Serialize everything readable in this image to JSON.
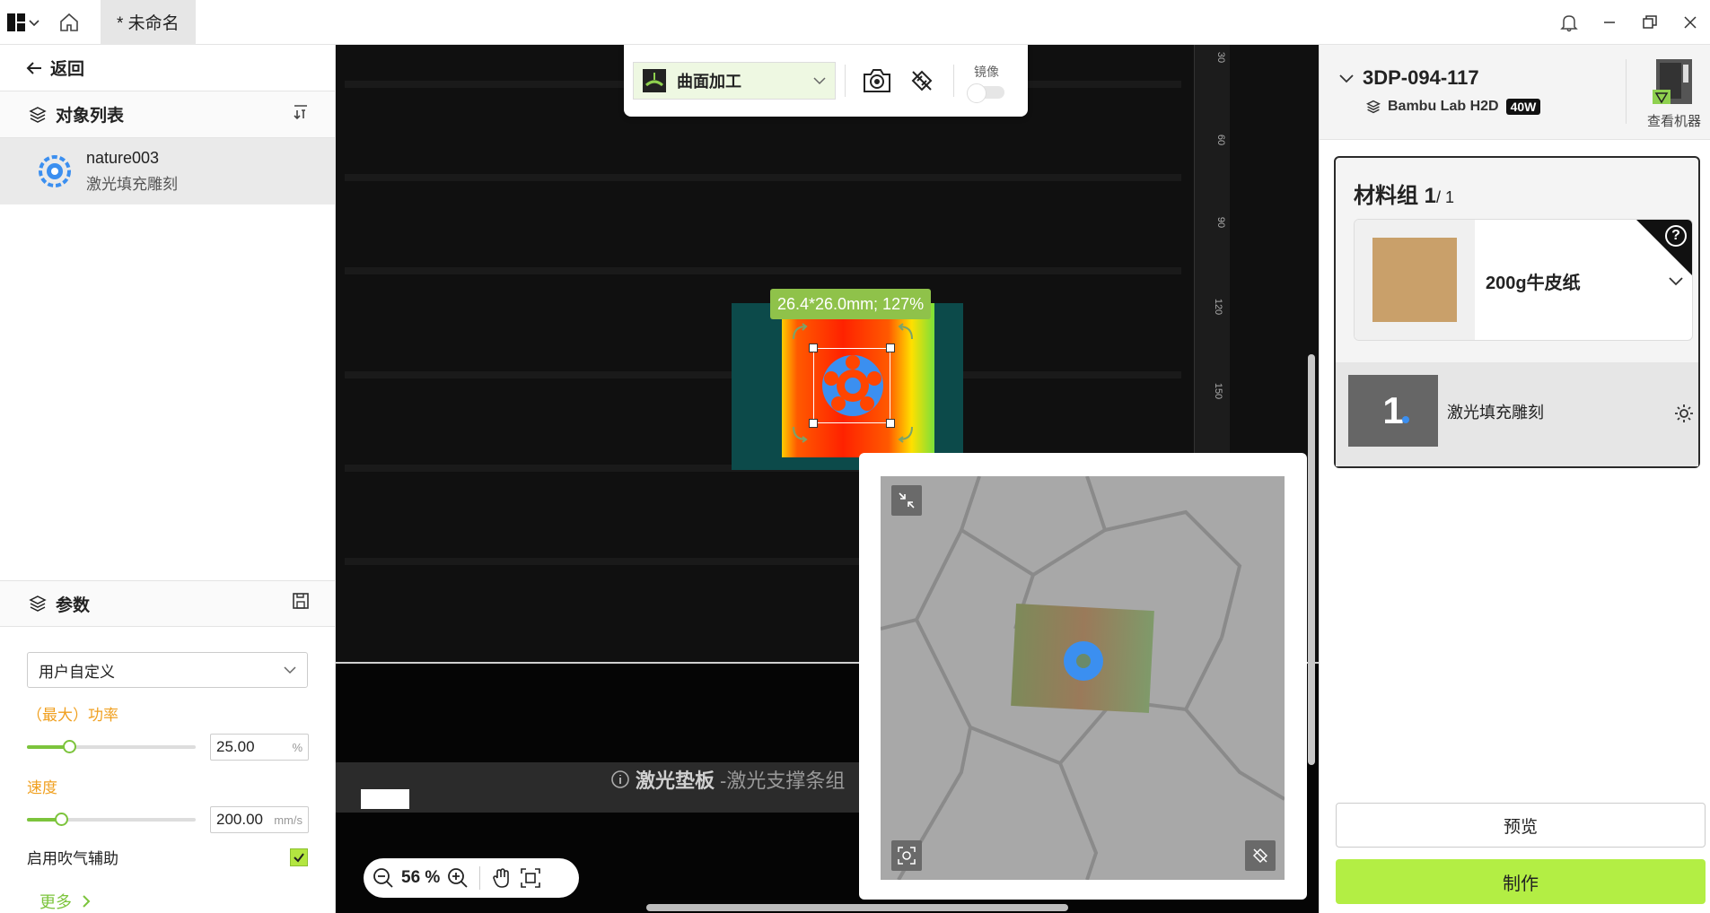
{
  "titlebar": {
    "tab_title": "* 未命名",
    "icons": [
      "app-logo-icon",
      "chevron-down-icon",
      "home-icon",
      "bell-icon",
      "minimize-icon",
      "restore-icon",
      "close-icon"
    ]
  },
  "left": {
    "back_label": "返回",
    "objects_header": "对象列表",
    "objects": [
      {
        "name": "nature003",
        "type": "激光填充雕刻"
      }
    ],
    "params_header": "参数",
    "preset": "用户自定义",
    "power_label": "（最大）功率",
    "power_value": "25.00",
    "power_unit": "%",
    "power_level": 0.25,
    "speed_label": "速度",
    "speed_value": "200.00",
    "speed_unit": "mm/s",
    "speed_level": 0.2,
    "air_assist_label": "启用吹气辅助",
    "air_assist_checked": true,
    "more_label": "更多"
  },
  "canvas": {
    "mode": "曲面加工",
    "mirror_label": "镜像",
    "size_tip": "26.4*26.0mm; 127%",
    "ruler_marks": [
      "30",
      "60",
      "90",
      "120",
      "150"
    ],
    "pad_title": "激光垫板",
    "pad_subtitle": "-激光支撑条组",
    "zoom": "56 %"
  },
  "right": {
    "machine_name": "3DP-094-117",
    "machine_model": "Bambu Lab H2D",
    "power_badge": "40W",
    "view_machine": "查看机器",
    "group_title": "材料组 1",
    "group_total": "/ 1",
    "material": "200g牛皮纸",
    "layer_number": "1",
    "layer_name": "激光填充雕刻",
    "preview_label": "预览",
    "make_label": "制作"
  },
  "colors": {
    "accent_green": "#b3ee44",
    "label_orange": "#f0a020",
    "object_blue": "#3b8ff0",
    "size_tip_green": "#8fc24a"
  }
}
